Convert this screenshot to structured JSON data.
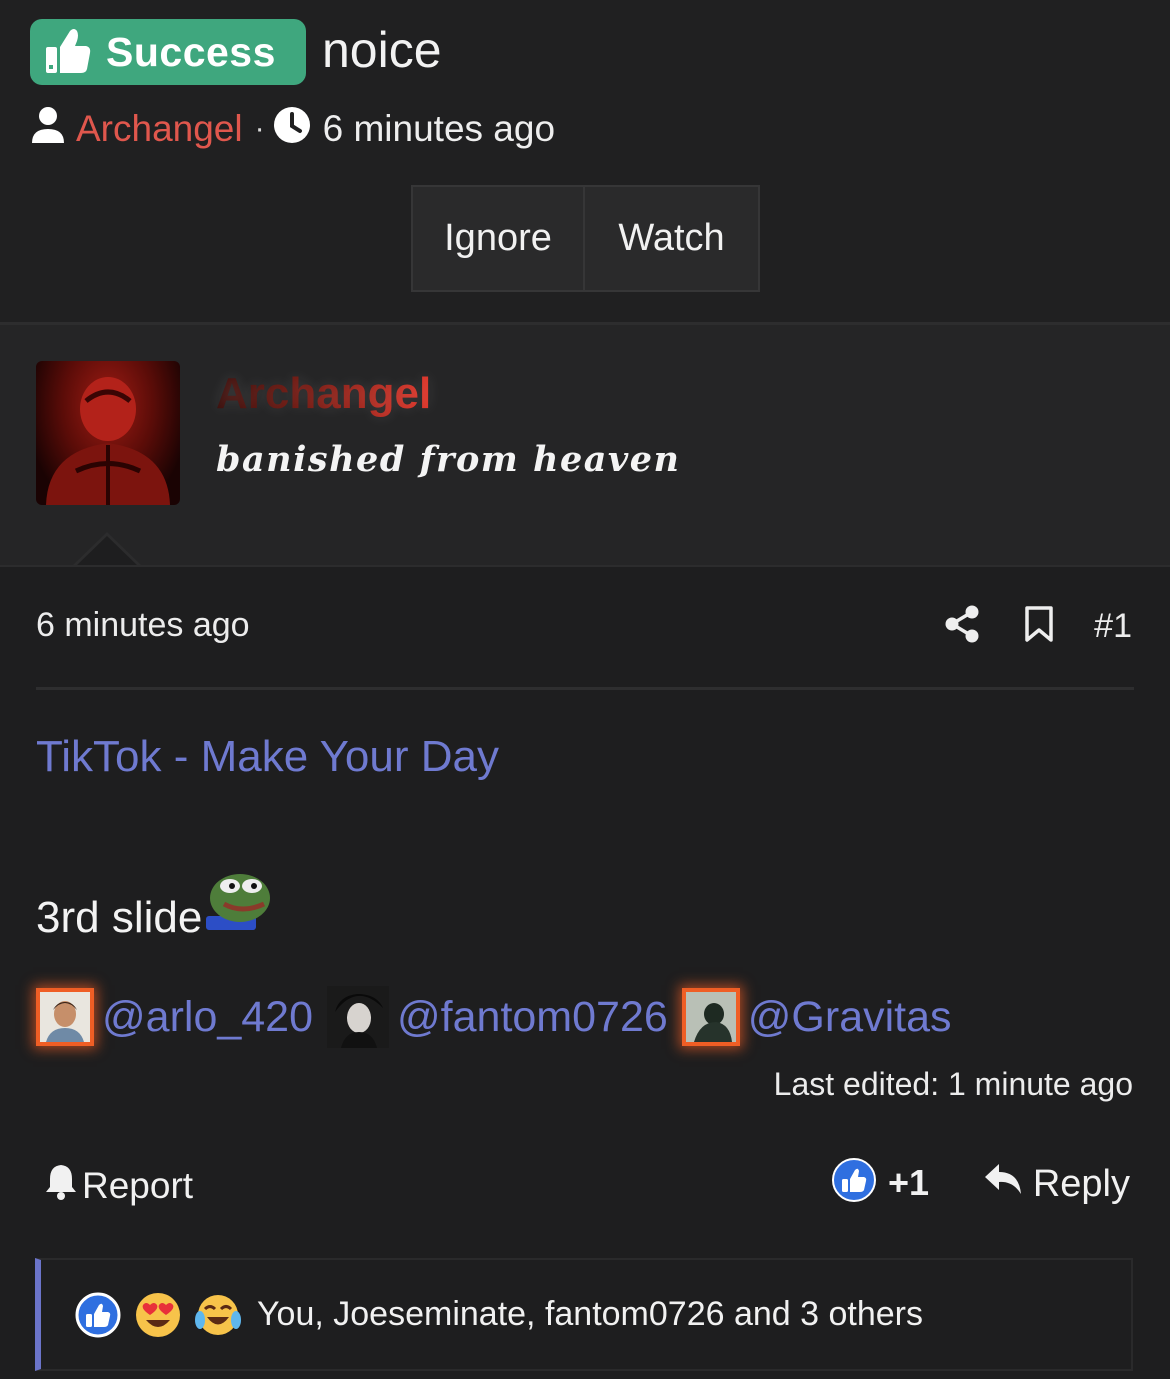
{
  "thread": {
    "badge_label": "Success",
    "title": "noice",
    "author": "Archangel",
    "separator": "·",
    "time": "6 minutes ago"
  },
  "actions": {
    "ignore_label": "Ignore",
    "watch_label": "Watch"
  },
  "profile": {
    "name": "Archangel",
    "tagline": "banished from heaven"
  },
  "post": {
    "time": "6 minutes ago",
    "number": "#1",
    "link_title": "TikTok - Make Your Day",
    "body": "3rd slide",
    "mentions": [
      "@arlo_420",
      "@fantom0726",
      "@Gravitas"
    ],
    "last_edited": "Last edited: 1 minute ago"
  },
  "footer": {
    "report_label": "Report",
    "vote_count": "+1",
    "reply_label": "Reply"
  },
  "reactions": {
    "summary": "You, Joeseminate, fantom0726 and 3 others",
    "emojis": [
      "thumbs-up",
      "heart-eyes",
      "tears-of-joy"
    ]
  },
  "colors": {
    "badge_bg": "#3fa77e",
    "author": "#e0574d",
    "link": "#6f7ad0",
    "accent_bar": "#6b74c9",
    "mention_glow": "#ef5e25"
  }
}
